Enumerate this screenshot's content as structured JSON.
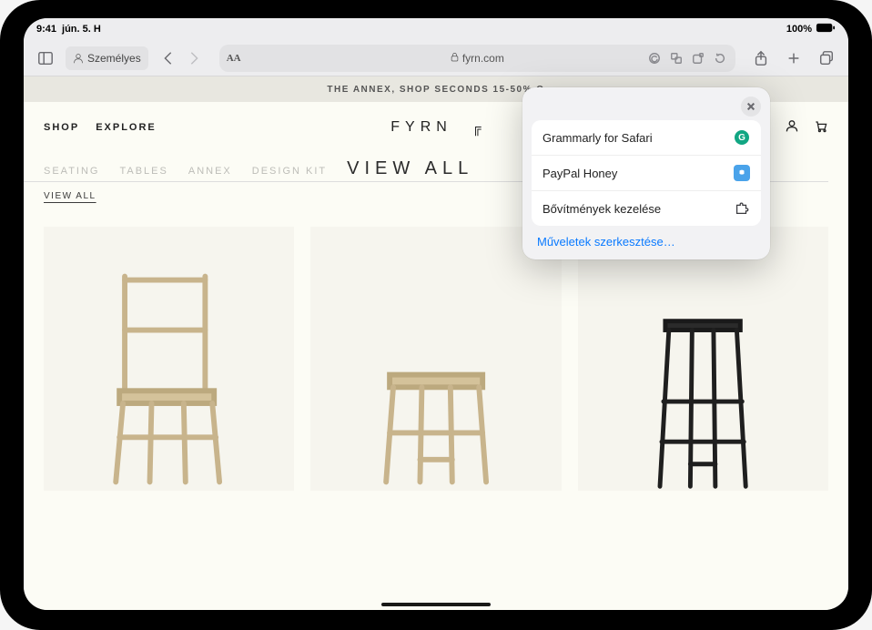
{
  "status": {
    "time": "9:41",
    "date": "jún. 5. H",
    "battery": "100%"
  },
  "toolbar": {
    "profile_label": "Személyes",
    "url_display": "fyrn.com",
    "text_size_label": "AA"
  },
  "banner": {
    "text": "THE ANNEX, SHOP SECONDS 15-50% O"
  },
  "site": {
    "nav_shop": "SHOP",
    "nav_explore": "EXPLORE",
    "logo_text": "FYRN",
    "logo_mark": "╔"
  },
  "categories": {
    "seating": "SEATING",
    "tables": "TABLES",
    "annex": "ANNEX",
    "design_kit": "DESIGN KIT",
    "view_all_title": "VIEW ALL",
    "view_all_sub": "VIEW ALL"
  },
  "popover": {
    "grammarly_label": "Grammarly for Safari",
    "honey_label": "PayPal Honey",
    "manage_label": "Bővítmények kezelése",
    "edit_actions_label": "Műveletek szerkesztése…"
  }
}
